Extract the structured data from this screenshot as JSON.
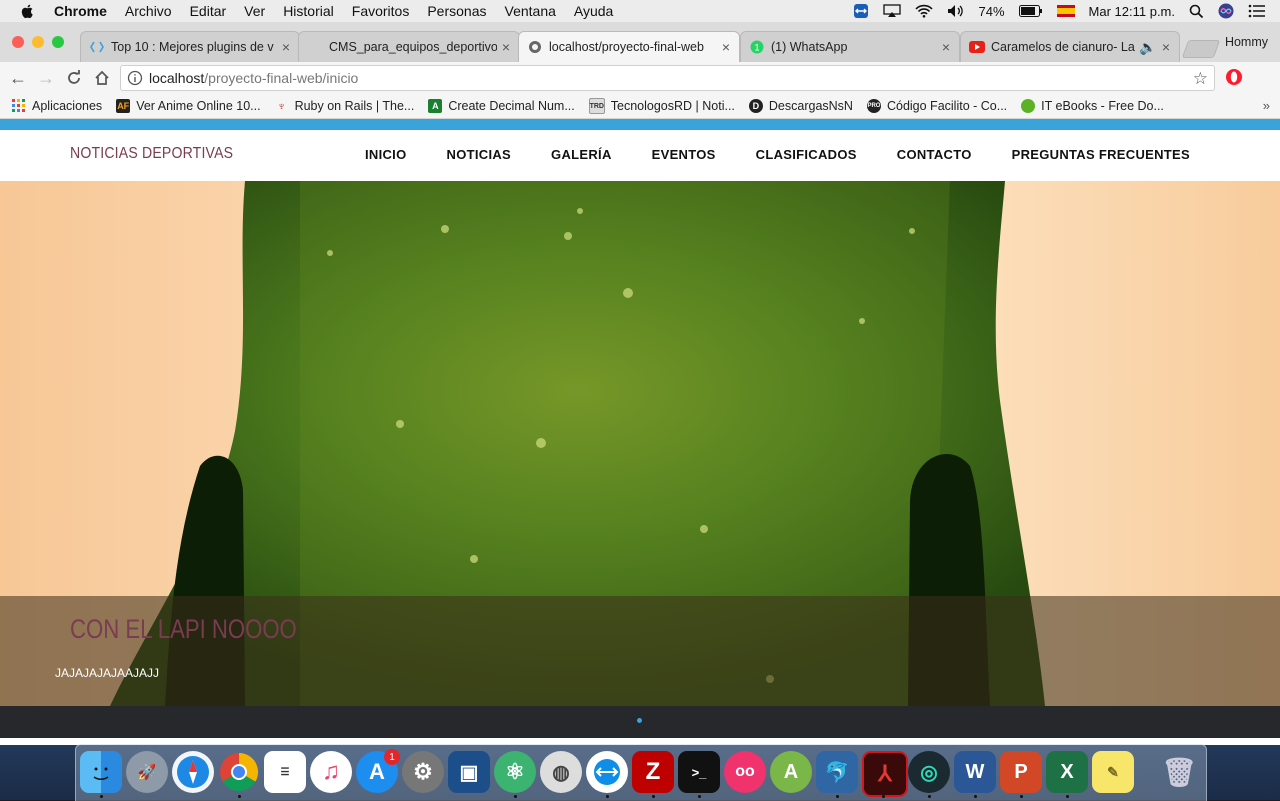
{
  "menubar": {
    "app": "Chrome",
    "items": [
      "Archivo",
      "Editar",
      "Ver",
      "Historial",
      "Favoritos",
      "Personas",
      "Ventana",
      "Ayuda"
    ],
    "battery": "74%",
    "clock": "Mar 12:11 p.m."
  },
  "tabs": [
    {
      "title": "Top 10 : Mejores plugins de v",
      "active": false
    },
    {
      "title": "CMS_para_equipos_deportivo",
      "active": false
    },
    {
      "title": "localhost/proyecto-final-web",
      "active": true
    },
    {
      "title": "(1) WhatsApp",
      "active": false
    },
    {
      "title": "Caramelos de cianuro- La",
      "active": false
    }
  ],
  "profile": "Hommy",
  "address": {
    "host": "localhost",
    "path": "/proyecto-final-web/inicio"
  },
  "bookmarks": [
    "Aplicaciones",
    "Ver Anime Online 10...",
    "Ruby on Rails | The...",
    "Create Decimal Num...",
    "TecnologosRD | Noti...",
    "DescargasNsN",
    "Código Facilito - Co...",
    "IT eBooks - Free Do..."
  ],
  "site": {
    "brand": "NOTICIAS DEPORTIVAS",
    "menu": [
      "INICIO",
      "NOTICIAS",
      "GALERÍA",
      "EVENTOS",
      "CLASIFICADOS",
      "CONTACTO",
      "PREGUNTAS FRECUENTES"
    ],
    "slide_title": "CON EL LAPI NOOOO",
    "slide_text": "JAJAJAJAJAAJAJJ"
  },
  "dock": {
    "apps": [
      "Finder",
      "Launchpad",
      "Safari",
      "Chrome",
      "Recordatorios",
      "iTunes",
      "App Store",
      "Preferencias del Sistema",
      "VirtualBox",
      "Atom",
      "Sequel Pro",
      "TeamViewer",
      "FileZilla",
      "Terminal",
      "Flickr",
      "Android Studio",
      "MySQL Workbench",
      "Acrobat",
      "GitKraken",
      "Word",
      "PowerPoint",
      "Excel",
      "Notas",
      "Papelera"
    ],
    "appstore_badge": "1"
  }
}
